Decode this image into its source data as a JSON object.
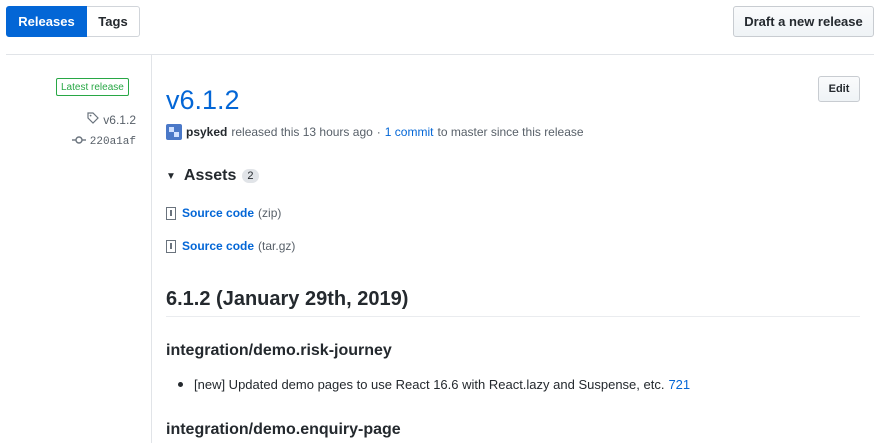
{
  "header": {
    "tabs": [
      {
        "label": "Releases",
        "active": true
      },
      {
        "label": "Tags",
        "active": false
      }
    ],
    "draft_button": "Draft a new release"
  },
  "sidebar": {
    "latest_label": "Latest release",
    "tag": "v6.1.2",
    "commit": "220a1af",
    "tag_icon": "tag-icon",
    "commit_icon": "git-commit-icon"
  },
  "release": {
    "title": "v6.1.2",
    "edit_button": "Edit",
    "author": "psyked",
    "released_text": "released this 13 hours ago",
    "separator": "·",
    "commits_link": "1 commit",
    "commits_suffix": "to master since this release"
  },
  "assets": {
    "heading": "Assets",
    "count": "2",
    "items": [
      {
        "name": "Source code",
        "ext": "(zip)"
      },
      {
        "name": "Source code",
        "ext": "(tar.gz)"
      }
    ]
  },
  "notes": {
    "version_heading": "6.1.2 (January 29th, 2019)",
    "sections": [
      {
        "heading": "integration/demo.risk-journey",
        "items": [
          {
            "text": "[new] Updated demo pages to use React 16.6 with React.lazy and Suspense, etc.",
            "link": "721"
          }
        ]
      },
      {
        "heading": "integration/demo.enquiry-page"
      }
    ]
  },
  "colors": {
    "accent": "#0366d6",
    "latest_green": "#28a745"
  }
}
